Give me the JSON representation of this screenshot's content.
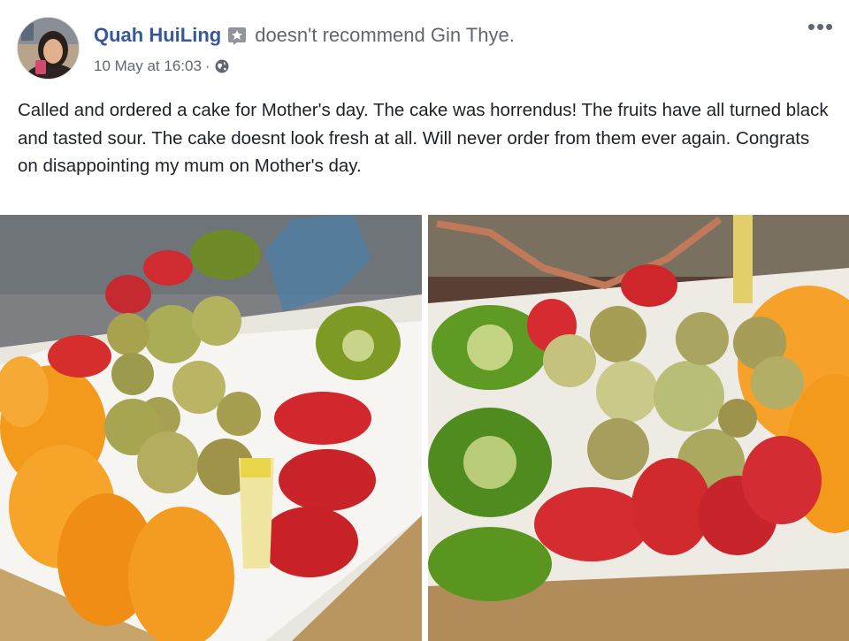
{
  "post": {
    "author": "Quah HuiLing",
    "action": "doesn't recommend Gin Thye.",
    "date": "10 May at 16:03",
    "separator": "·",
    "privacy_icon": "globe-icon",
    "review_icon": "review-badge-icon",
    "more_icon": "more-options-icon",
    "more_label": "•••",
    "text": "Called and ordered a cake for Mother's day. The cake was horrendus! The fruits have all turned black and tasted sour. The cake doesnt look fresh at all. Will never order from them ever again. Congrats on disappointing my mum on Mother's day.",
    "photos": [
      {
        "name": "cake-photo-left"
      },
      {
        "name": "cake-photo-right"
      }
    ]
  },
  "colors": {
    "author_link": "#365899",
    "meta_gray": "#616770",
    "body_text": "#1d2129"
  }
}
